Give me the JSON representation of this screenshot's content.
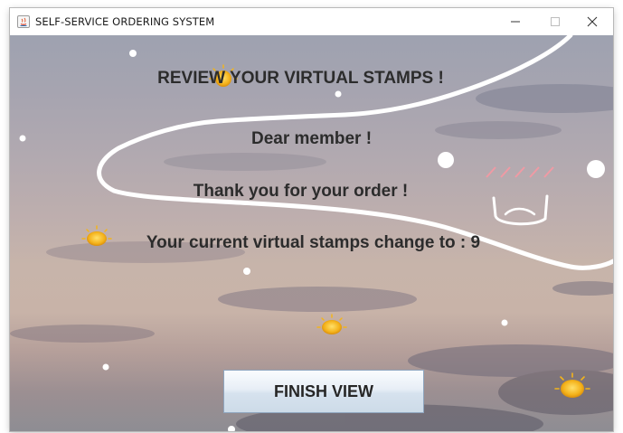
{
  "window": {
    "title": "SELF-SERVICE ORDERING SYSTEM",
    "controls": {
      "minimize": "–",
      "maximize": "□",
      "close": "✕"
    }
  },
  "main": {
    "headline": "REVIEW YOUR VIRTUAL STAMPS !",
    "greeting": "Dear member !",
    "thanks": "Thank you for your order !",
    "stamps_message": "Your current virtual stamps change to : 9",
    "finish_button_label": "FINISH VIEW"
  },
  "decorations": {
    "icons": [
      "sun-icon",
      "doodle-face-icon",
      "dot-icon"
    ],
    "colors": {
      "sun": "#f3b41c",
      "doodle": "#ffffff",
      "blush": "#f09aa4"
    }
  }
}
